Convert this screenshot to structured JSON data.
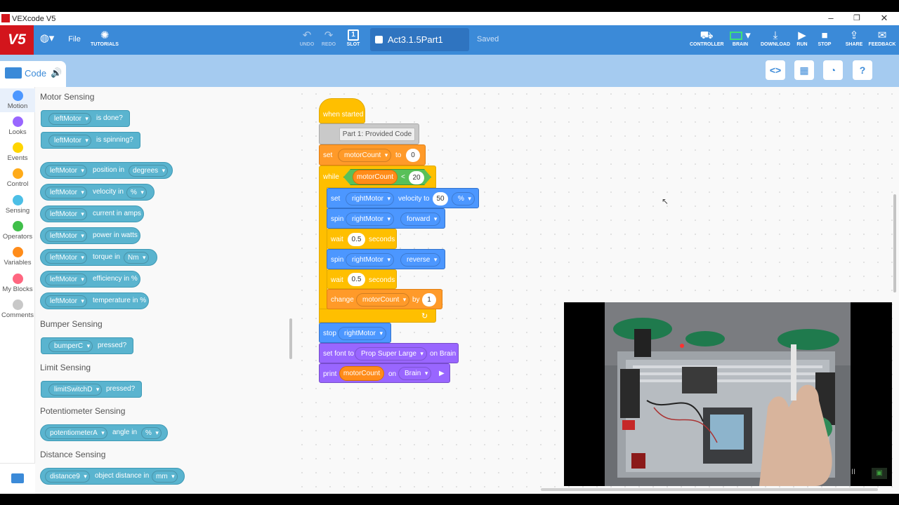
{
  "window": {
    "title": "VEXcode V5",
    "minimize": "–",
    "maximize": "❐",
    "close": "✕"
  },
  "toolbar": {
    "logo": "V5",
    "file": "File",
    "tutorials": "TUTORIALS",
    "undo": "UNDO",
    "redo": "REDO",
    "slot": "SLOT",
    "slot_number": "1",
    "project_name": "Act3.1.5Part1",
    "status": "Saved",
    "controller": "CONTROLLER",
    "brain": "BRAIN",
    "download": "DOWNLOAD",
    "run": "RUN",
    "stop": "STOP",
    "share": "SHARE",
    "feedback": "FEEDBACK"
  },
  "subbar": {
    "code_tab": "Code",
    "right_icons": [
      "code-view-icon",
      "devices-icon",
      "dashboard-icon",
      "help-icon"
    ]
  },
  "categories": [
    {
      "label": "Motion",
      "color": "#4c97ff"
    },
    {
      "label": "Looks",
      "color": "#9966ff"
    },
    {
      "label": "Events",
      "color": "#ffd500"
    },
    {
      "label": "Control",
      "color": "#ffab19"
    },
    {
      "label": "Sensing",
      "color": "#4cbfe6"
    },
    {
      "label": "Operators",
      "color": "#40bf4a"
    },
    {
      "label": "Variables",
      "color": "#ff8c1a"
    },
    {
      "label": "My Blocks",
      "color": "#ff6680"
    },
    {
      "label": "Comments",
      "color": "#c8c8c8"
    }
  ],
  "palette": {
    "motor_sensing": "Motor Sensing",
    "is_done": {
      "motor": "leftMotor",
      "text": "is done?"
    },
    "is_spinning": {
      "motor": "leftMotor",
      "text": "is spinning?"
    },
    "position": {
      "motor": "leftMotor",
      "text": "position in",
      "unit": "degrees"
    },
    "velocity": {
      "motor": "leftMotor",
      "text": "velocity in",
      "unit": "%"
    },
    "current": {
      "motor": "leftMotor",
      "text": "current in amps"
    },
    "power": {
      "motor": "leftMotor",
      "text": "power in watts"
    },
    "torque": {
      "motor": "leftMotor",
      "text": "torque in",
      "unit": "Nm"
    },
    "efficiency": {
      "motor": "leftMotor",
      "text": "efficiency in %"
    },
    "temperature": {
      "motor": "leftMotor",
      "text": "temperature in %"
    },
    "bumper_sensing": "Bumper Sensing",
    "bumper": {
      "device": "bumperC",
      "text": "pressed?"
    },
    "limit_sensing": "Limit Sensing",
    "limit": {
      "device": "limitSwitchD",
      "text": "pressed?"
    },
    "potentiometer_sensing": "Potentiometer Sensing",
    "potentiometer": {
      "device": "potentiometerA",
      "text": "angle in",
      "unit": "%"
    },
    "distance_sensing": "Distance Sensing",
    "distance": {
      "device": "distance9",
      "text": "object distance in",
      "unit": "mm"
    }
  },
  "program": {
    "when_started": "when started",
    "comment": "Part 1: Provided Code",
    "set_var": {
      "set": "set",
      "var": "motorCount",
      "to": "to",
      "value": "0"
    },
    "while": {
      "label": "while",
      "var": "motorCount",
      "op": "<",
      "value": "20"
    },
    "set_velocity": {
      "set": "set",
      "motor": "rightMotor",
      "text": "velocity to",
      "value": "50",
      "unit": "%"
    },
    "spin1": {
      "spin": "spin",
      "motor": "rightMotor",
      "dir": "forward"
    },
    "wait1": {
      "wait": "wait",
      "value": "0.5",
      "unit": "seconds"
    },
    "spin2": {
      "spin": "spin",
      "motor": "rightMotor",
      "dir": "reverse"
    },
    "wait2": {
      "wait": "wait",
      "value": "0.5",
      "unit": "seconds"
    },
    "change": {
      "change": "change",
      "var": "motorCount",
      "by": "by",
      "value": "1"
    },
    "loop_arrow": "↻",
    "stop": {
      "stop": "stop",
      "motor": "rightMotor"
    },
    "set_font": {
      "text": "set font to",
      "font": "Prop Super Large",
      "on": "on Brain"
    },
    "print": {
      "print": "print",
      "var": "motorCount",
      "on": "on",
      "target": "Brain",
      "play": "▶"
    }
  },
  "video": {
    "pause": "II",
    "cc": "▣"
  }
}
